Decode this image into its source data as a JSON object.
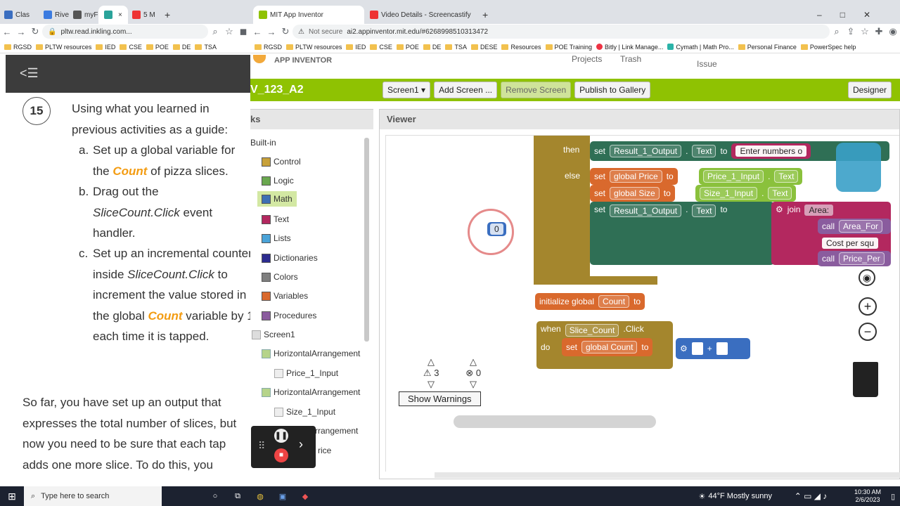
{
  "left_window": {
    "tabs": [
      "Clas",
      "Rive",
      "myF",
      "",
      "5 M"
    ],
    "url": "pltw.read.inkling.com...",
    "bookmarks": [
      "RGSD",
      "PLTW resources",
      "IED",
      "CSE",
      "POE",
      "DE",
      "TSA"
    ],
    "header_icon": "<☰",
    "step_number": "15",
    "intro": "Using what you learned in previous activities as a guide:",
    "items": [
      {
        "marker": "a.",
        "pre": "Set up a global variable for the ",
        "highlight": "Count",
        "post": " of pizza slices."
      },
      {
        "marker": "b.",
        "pre": "Drag out the ",
        "em": "SliceCount.Click",
        "post": " event handler."
      },
      {
        "marker": "c.",
        "pre": "Set up an incremental counter inside ",
        "em": "SliceCount.Click",
        "mid": " to increment the value stored in the global ",
        "highlight": "Count",
        "post": " variable by 1 each time it is tapped."
      }
    ],
    "para": "So far, you have set up an output that expresses the total number of slices, but now you need to be sure that each tap adds one more slice. To do this, you"
  },
  "right_window": {
    "tabs": [
      "MIT App Inventor",
      "Video Details - Screencastify"
    ],
    "secure_label": "Not secure",
    "url": "ai2.appinventor.mit.edu/#6268998510313472",
    "bookmarks": [
      "RGSD",
      "PLTW resources",
      "IED",
      "CSE",
      "POE",
      "DE",
      "TSA",
      "DESE",
      "Resources",
      "POE Training",
      "Bitly | Link Manage...",
      "Cymath | Math Pro...",
      "Personal Finance",
      "PowerSpec help"
    ],
    "app_name": "APP INVENTOR",
    "top_menu": [
      "Projects",
      "Trash",
      "Issue"
    ],
    "project_title": "V_123_A2",
    "toolbar": {
      "screen": "Screen1 ▾",
      "add": "Add Screen ...",
      "remove": "Remove Screen",
      "publish": "Publish to Gallery",
      "designer": "Designer"
    },
    "panel_title": "ks",
    "builtin": "Built-in",
    "blocks": [
      {
        "label": "Control",
        "color": "#c8a13a"
      },
      {
        "label": "Logic",
        "color": "#6aa84f"
      },
      {
        "label": "Math",
        "color": "#3d6fb4"
      },
      {
        "label": "Text",
        "color": "#b3285f"
      },
      {
        "label": "Lists",
        "color": "#4aa3d8"
      },
      {
        "label": "Dictionaries",
        "color": "#2c2b8f"
      },
      {
        "label": "Colors",
        "color": "#7f7f7f"
      },
      {
        "label": "Variables",
        "color": "#d9692d"
      },
      {
        "label": "Procedures",
        "color": "#8a5c9e"
      }
    ],
    "tree": [
      "Screen1",
      "HorizontalArrangement",
      "Price_1_Input",
      "HorizontalArrangement",
      "Size_1_Input",
      "Arrangement",
      "rice"
    ],
    "viewer_title": "Viewer",
    "code": {
      "then": "then",
      "else": "else",
      "set": "set",
      "to": "to",
      "join": "join",
      "call": "call",
      "result_output": "Result_1_Output",
      "text": "Text",
      "enter_numbers": "Enter numbers o",
      "global_price": "global Price",
      "price_input": "Price_1_Input",
      "global_size": "global Size",
      "size_input": "Size_1_Input",
      "area": "Area:",
      "area_fn": "Area_For",
      "cost": "Cost per squ",
      "price_per": "Price_Per",
      "init_global": "initialize global",
      "count": "Count",
      "when": "when",
      "slice_count": "Slice_Count",
      "click": ".Click",
      "do": "do",
      "global_count": "global Count",
      "plus": "+",
      "dragged_value": "0"
    },
    "warnings": {
      "warn_count": "3",
      "error_count": "0",
      "button": "Show Warnings"
    }
  },
  "taskbar": {
    "search": "Type here to search",
    "weather": "44°F  Mostly sunny",
    "time": "10:30 AM",
    "date": "2/6/2023"
  }
}
